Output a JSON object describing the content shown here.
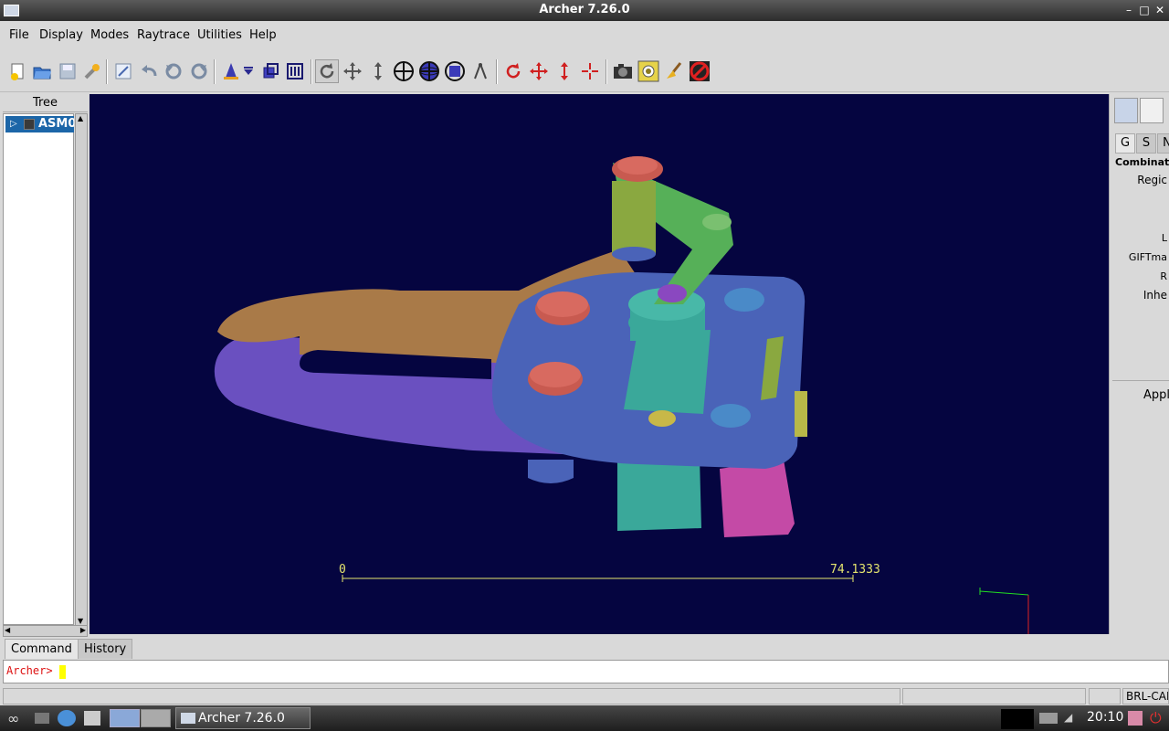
{
  "window": {
    "title": "Archer 7.26.0",
    "controls": [
      "minimize-icon",
      "maximize-icon",
      "close-icon"
    ]
  },
  "menubar": [
    "File",
    "Display",
    "Modes",
    "Raytrace",
    "Utilities",
    "Help"
  ],
  "toolbar": {
    "buttons": [
      {
        "name": "new-database-icon",
        "pressed": false
      },
      {
        "name": "open-folder-icon",
        "pressed": false
      },
      {
        "name": "save-icon",
        "pressed": false
      },
      {
        "name": "preferences-wrench-icon",
        "pressed": false
      },
      {
        "name": "edit-icon",
        "pressed": false
      },
      {
        "name": "undo-icon",
        "pressed": false
      },
      {
        "name": "revert-icon",
        "pressed": false
      },
      {
        "name": "redo-icon",
        "pressed": false
      },
      {
        "name": "wizard-icon",
        "pressed": false
      },
      {
        "name": "dropdown-arrow-icon",
        "pressed": false
      },
      {
        "name": "primitive-icon",
        "pressed": false
      },
      {
        "name": "combination-icon",
        "pressed": false
      },
      {
        "name": "rotate-view-icon",
        "pressed": true
      },
      {
        "name": "translate-view-icon",
        "pressed": false
      },
      {
        "name": "scale-view-icon",
        "pressed": false
      },
      {
        "name": "center-view-icon",
        "pressed": false
      },
      {
        "name": "sphere-view-icon",
        "pressed": false
      },
      {
        "name": "cube-view-icon",
        "pressed": false
      },
      {
        "name": "measure-icon",
        "pressed": false
      },
      {
        "name": "rotate-object-icon",
        "pressed": false
      },
      {
        "name": "translate-object-icon",
        "pressed": false
      },
      {
        "name": "scale-object-icon",
        "pressed": false
      },
      {
        "name": "center-object-icon",
        "pressed": false
      },
      {
        "name": "raytrace-camera-icon",
        "pressed": false
      },
      {
        "name": "framebuffer-icon",
        "pressed": false
      },
      {
        "name": "clear-broom-icon",
        "pressed": false
      },
      {
        "name": "stop-raytrace-icon",
        "pressed": false
      }
    ]
  },
  "tree": {
    "header": "Tree",
    "items": [
      {
        "label": "ASM0"
      }
    ]
  },
  "viewport": {
    "scale_start": "0",
    "scale_end": "74.1333",
    "colors": {
      "background": "#050540",
      "scale": "#e6e66e",
      "axis_x": "#dd2222",
      "axis_y": "#22dd22",
      "axis_z": "#4444ff"
    }
  },
  "right_panel": {
    "tabs": [
      "G",
      "S",
      "N"
    ],
    "labels": [
      "Combinatio",
      "Regic",
      "L",
      "GIFTma",
      "R",
      "Inhe"
    ],
    "apply_label": "Appl",
    "icons": [
      "edit-attributes-icon",
      "text-view-icon"
    ]
  },
  "command": {
    "tabs": [
      "Command",
      "History"
    ],
    "prompt": "Archer>",
    "value": ""
  },
  "statusbar": {
    "right_text": "BRL-CAD"
  },
  "taskbar": {
    "window_label": "Archer 7.26.0",
    "clock": "20:10"
  }
}
